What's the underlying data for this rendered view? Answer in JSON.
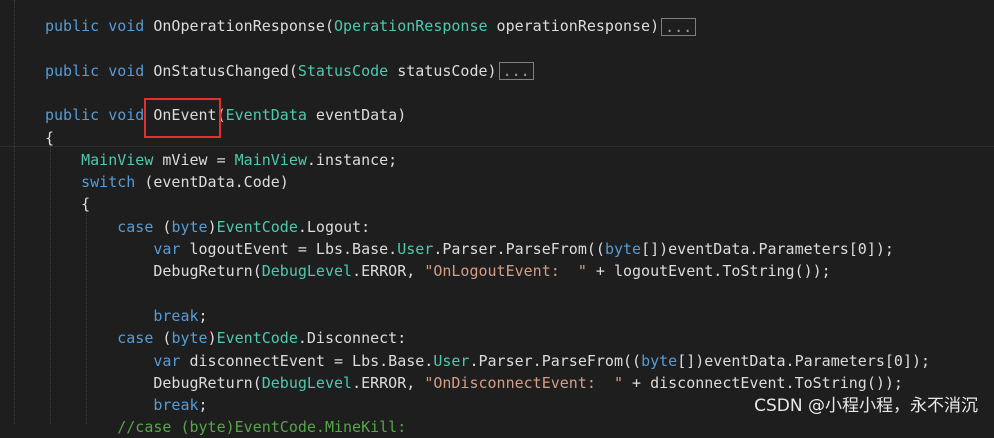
{
  "lines": [
    {
      "tokens": [
        {
          "c": "kw",
          "t": "public"
        },
        {
          "c": "pl",
          "t": " "
        },
        {
          "c": "kw",
          "t": "void"
        },
        {
          "c": "pl",
          "t": " OnOperationResponse("
        },
        {
          "c": "ty",
          "t": "OperationResponse"
        },
        {
          "c": "pl",
          "t": " operationResponse)"
        }
      ],
      "collapsed": "..."
    },
    {
      "tokens": []
    },
    {
      "tokens": [
        {
          "c": "kw",
          "t": "public"
        },
        {
          "c": "pl",
          "t": " "
        },
        {
          "c": "kw",
          "t": "void"
        },
        {
          "c": "pl",
          "t": " OnStatusChanged("
        },
        {
          "c": "ty",
          "t": "StatusCode"
        },
        {
          "c": "pl",
          "t": " statusCode)"
        }
      ],
      "collapsed": "..."
    },
    {
      "tokens": []
    },
    {
      "tokens": [
        {
          "c": "kw",
          "t": "public"
        },
        {
          "c": "pl",
          "t": " "
        },
        {
          "c": "kw",
          "t": "void"
        },
        {
          "c": "pl",
          "t": " OnEvent("
        },
        {
          "c": "ty",
          "t": "EventData"
        },
        {
          "c": "pl",
          "t": " eventData)"
        }
      ]
    },
    {
      "tokens": [
        {
          "c": "pl",
          "t": "{"
        }
      ]
    },
    {
      "tokens": [
        {
          "c": "pl",
          "t": "    "
        },
        {
          "c": "ty",
          "t": "MainView"
        },
        {
          "c": "pl",
          "t": " mView = "
        },
        {
          "c": "ty",
          "t": "MainView"
        },
        {
          "c": "pl",
          "t": ".instance;"
        }
      ]
    },
    {
      "tokens": [
        {
          "c": "pl",
          "t": "    "
        },
        {
          "c": "kw",
          "t": "switch"
        },
        {
          "c": "pl",
          "t": " (eventData.Code)"
        }
      ]
    },
    {
      "tokens": [
        {
          "c": "pl",
          "t": "    {"
        }
      ]
    },
    {
      "tokens": [
        {
          "c": "pl",
          "t": "        "
        },
        {
          "c": "kw",
          "t": "case"
        },
        {
          "c": "pl",
          "t": " ("
        },
        {
          "c": "kw",
          "t": "byte"
        },
        {
          "c": "pl",
          "t": ")"
        },
        {
          "c": "ty",
          "t": "EventCode"
        },
        {
          "c": "pl",
          "t": ".Logout:"
        }
      ]
    },
    {
      "tokens": [
        {
          "c": "pl",
          "t": "            "
        },
        {
          "c": "kw",
          "t": "var"
        },
        {
          "c": "pl",
          "t": " logoutEvent = Lbs.Base."
        },
        {
          "c": "ty",
          "t": "User"
        },
        {
          "c": "pl",
          "t": ".Parser.ParseFrom(("
        },
        {
          "c": "kw",
          "t": "byte"
        },
        {
          "c": "pl",
          "t": "[])eventData.Parameters[0]);"
        }
      ]
    },
    {
      "tokens": [
        {
          "c": "pl",
          "t": "            DebugReturn("
        },
        {
          "c": "ty",
          "t": "DebugLevel"
        },
        {
          "c": "pl",
          "t": ".ERROR, "
        },
        {
          "c": "str",
          "t": "\"OnLogoutEvent:  \""
        },
        {
          "c": "pl",
          "t": " + logoutEvent.ToString());"
        }
      ]
    },
    {
      "tokens": []
    },
    {
      "tokens": [
        {
          "c": "pl",
          "t": "            "
        },
        {
          "c": "kw",
          "t": "break"
        },
        {
          "c": "pl",
          "t": ";"
        }
      ]
    },
    {
      "tokens": [
        {
          "c": "pl",
          "t": "        "
        },
        {
          "c": "kw",
          "t": "case"
        },
        {
          "c": "pl",
          "t": " ("
        },
        {
          "c": "kw",
          "t": "byte"
        },
        {
          "c": "pl",
          "t": ")"
        },
        {
          "c": "ty",
          "t": "EventCode"
        },
        {
          "c": "pl",
          "t": ".Disconnect:"
        }
      ]
    },
    {
      "tokens": [
        {
          "c": "pl",
          "t": "            "
        },
        {
          "c": "kw",
          "t": "var"
        },
        {
          "c": "pl",
          "t": " disconnectEvent = Lbs.Base."
        },
        {
          "c": "ty",
          "t": "User"
        },
        {
          "c": "pl",
          "t": ".Parser.ParseFrom(("
        },
        {
          "c": "kw",
          "t": "byte"
        },
        {
          "c": "pl",
          "t": "[])eventData.Parameters[0]);"
        }
      ]
    },
    {
      "tokens": [
        {
          "c": "pl",
          "t": "            DebugReturn("
        },
        {
          "c": "ty",
          "t": "DebugLevel"
        },
        {
          "c": "pl",
          "t": ".ERROR, "
        },
        {
          "c": "str",
          "t": "\"OnDisconnectEvent:  \""
        },
        {
          "c": "pl",
          "t": " + disconnectEvent.ToString());"
        }
      ]
    },
    {
      "tokens": [
        {
          "c": "pl",
          "t": "            "
        },
        {
          "c": "kw",
          "t": "break"
        },
        {
          "c": "pl",
          "t": ";"
        }
      ]
    },
    {
      "tokens": [
        {
          "c": "cm",
          "t": "        //case (byte)EventCode.MineKill:"
        }
      ]
    }
  ],
  "watermark": "CSDN @小程小程，永不消沉",
  "colors": {
    "keyword": "#569cd6",
    "type": "#4ec9b0",
    "string": "#d69d85",
    "comment": "#57a64a",
    "highlight_box": "#e03030"
  }
}
